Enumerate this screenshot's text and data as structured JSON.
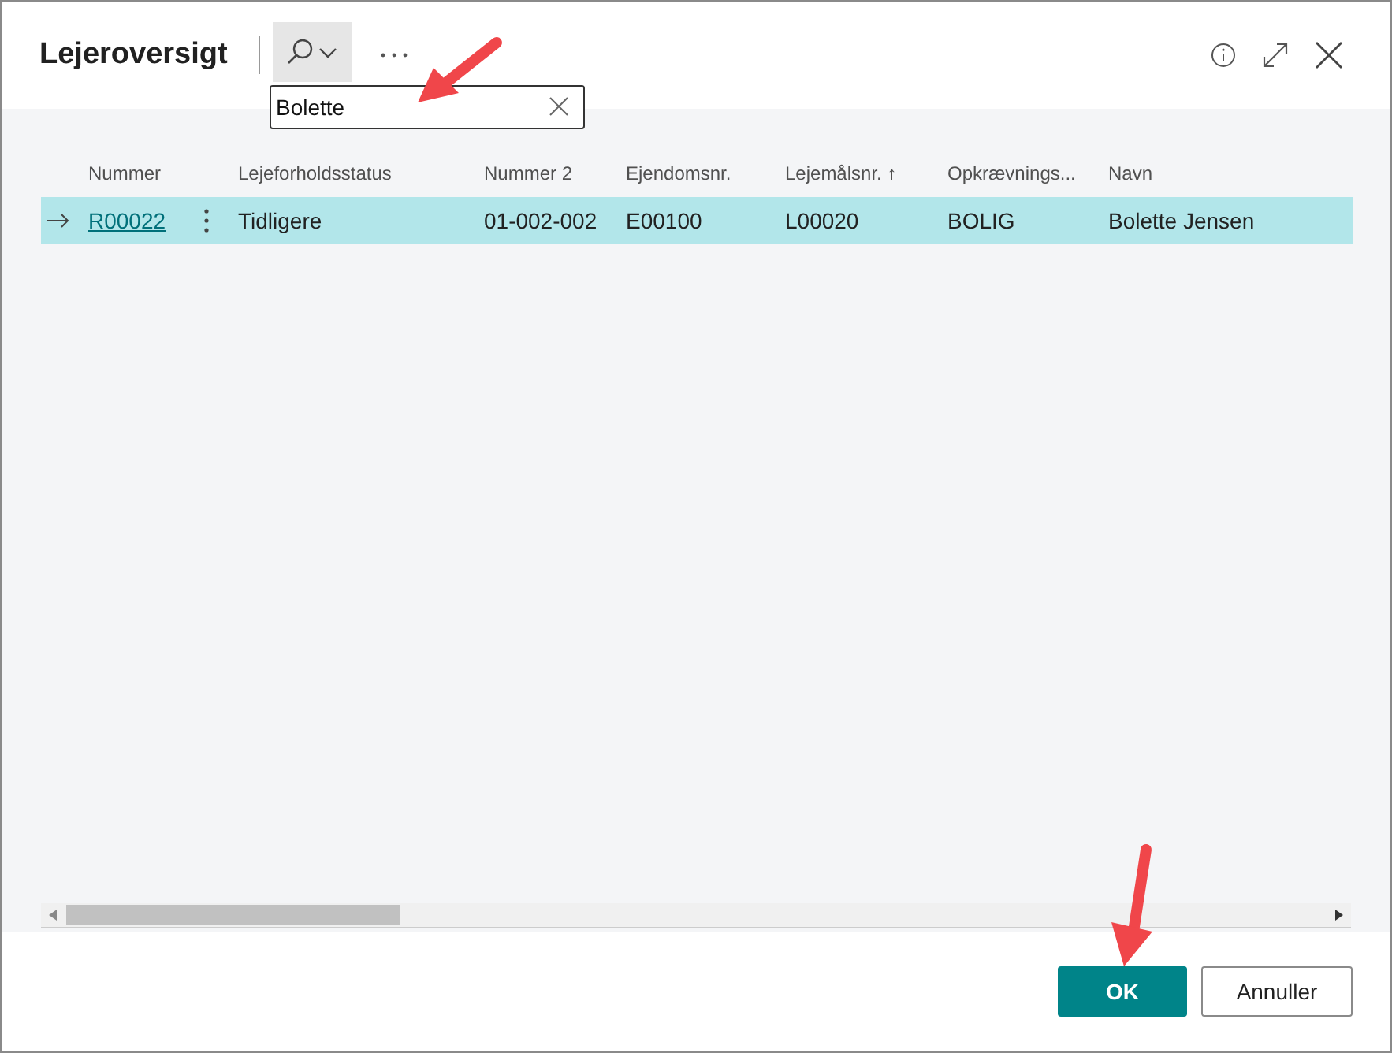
{
  "window": {
    "title": "Lejeroversigt"
  },
  "search": {
    "value": "Bolette"
  },
  "table": {
    "columns": [
      {
        "label": "Nummer"
      },
      {
        "label": "Lejeforholdsstatus"
      },
      {
        "label": "Nummer 2"
      },
      {
        "label": "Ejendomsnr."
      },
      {
        "label": "Lejemålsnr. ↑"
      },
      {
        "label": "Opkrævnings..."
      },
      {
        "label": "Navn"
      }
    ],
    "rows": [
      {
        "selected": true,
        "cells": [
          "R00022",
          "Tidligere",
          "01-002-002",
          "E00100",
          "L00020",
          "BOLIG",
          "Bolette Jensen"
        ]
      }
    ]
  },
  "buttons": [
    {
      "label": "OK",
      "kind": "primary"
    },
    {
      "label": "Annuller",
      "kind": "secondary"
    }
  ]
}
